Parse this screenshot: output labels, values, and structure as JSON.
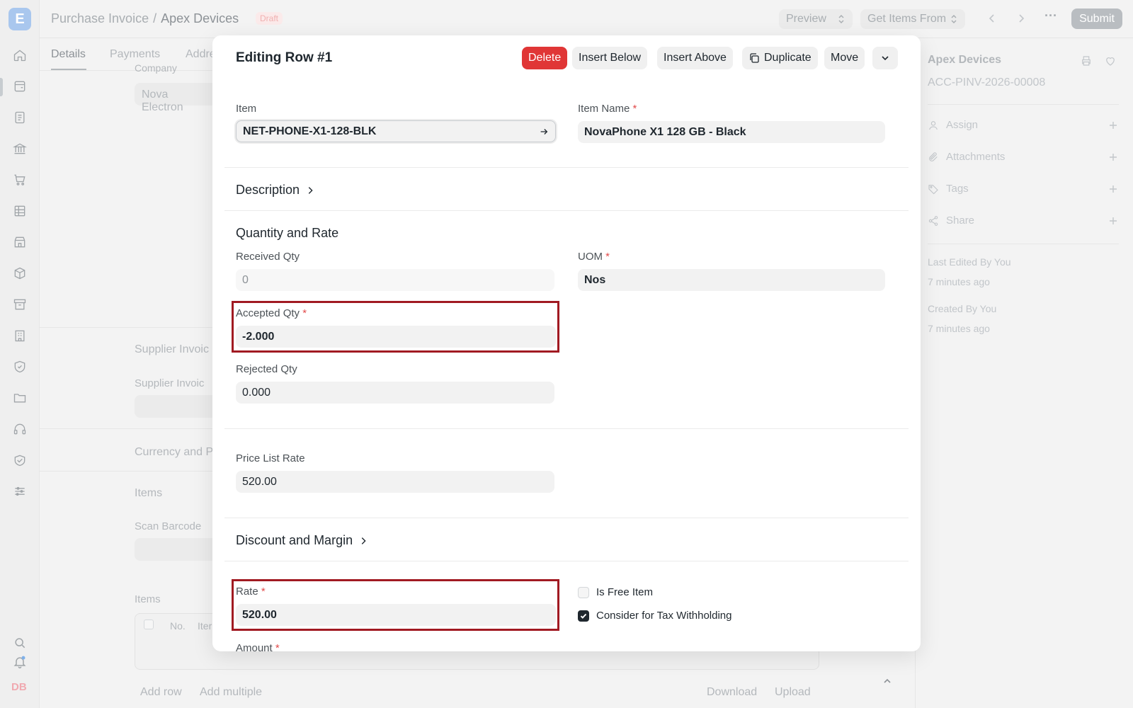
{
  "app": {
    "logo_letter": "E",
    "user_initials": "DB"
  },
  "breadcrumb": {
    "parent": "Purchase Invoice",
    "separator": "/",
    "current": "Apex Devices",
    "status": "Draft"
  },
  "toolbar": {
    "preview_label": "Preview",
    "get_items_label": "Get Items From",
    "more_label": "···",
    "submit_label": "Submit"
  },
  "bg_form": {
    "tabs": [
      "Details",
      "Payments",
      "Addre"
    ],
    "company_label": "Company",
    "company_value": "Nova Electron",
    "supplier_invoice_section": "Supplier Invoic",
    "supplier_invoice_label": "Supplier Invoic",
    "currency_section": "Currency and P",
    "items_section": "Items",
    "scan_barcode_label": "Scan Barcode",
    "items_label": "Items",
    "grid_headers": [
      "No.",
      "Iter"
    ],
    "add_row": "Add row",
    "add_multiple": "Add multiple",
    "download": "Download",
    "upload": "Upload"
  },
  "sidebar": {
    "title": "Apex Devices",
    "doc_id": "ACC-PINV-2026-00008",
    "rows": [
      {
        "label": "Assign",
        "icon": "user-icon"
      },
      {
        "label": "Attachments",
        "icon": "paperclip-icon"
      },
      {
        "label": "Tags",
        "icon": "tag-icon"
      },
      {
        "label": "Share",
        "icon": "share-icon"
      }
    ],
    "last_edited": "Last Edited By You",
    "last_edited_time": "7 minutes ago",
    "created": "Created By You",
    "created_time": "7 minutes ago"
  },
  "modal": {
    "title": "Editing Row #1",
    "buttons": {
      "delete": "Delete",
      "insert_below": "Insert Below",
      "insert_above": "Insert Above",
      "duplicate": "Duplicate",
      "move": "Move"
    },
    "item_label": "Item",
    "item_value": "NET-PHONE-X1-128-BLK",
    "item_name_label": "Item Name",
    "item_name_value": "NovaPhone X1 128 GB - Black",
    "description_section": "Description",
    "qty_section": "Quantity and Rate",
    "received_qty_label": "Received Qty",
    "received_qty_value": "0",
    "uom_label": "UOM",
    "uom_value": "Nos",
    "accepted_qty_label": "Accepted Qty",
    "accepted_qty_value": "-2.000",
    "rejected_qty_label": "Rejected Qty",
    "rejected_qty_value": "0.000",
    "price_list_rate_label": "Price List Rate",
    "price_list_rate_value": "520.00",
    "discount_section": "Discount and Margin",
    "rate_label": "Rate",
    "rate_value": "520.00",
    "is_free_item_label": "Is Free Item",
    "is_free_item_checked": false,
    "tax_withholding_label": "Consider for Tax Withholding",
    "tax_withholding_checked": true,
    "amount_label": "Amount",
    "required_mark": "*"
  },
  "colors": {
    "highlight": "#a11a22",
    "delete": "#e03636",
    "logo": "#a9c7ee"
  }
}
